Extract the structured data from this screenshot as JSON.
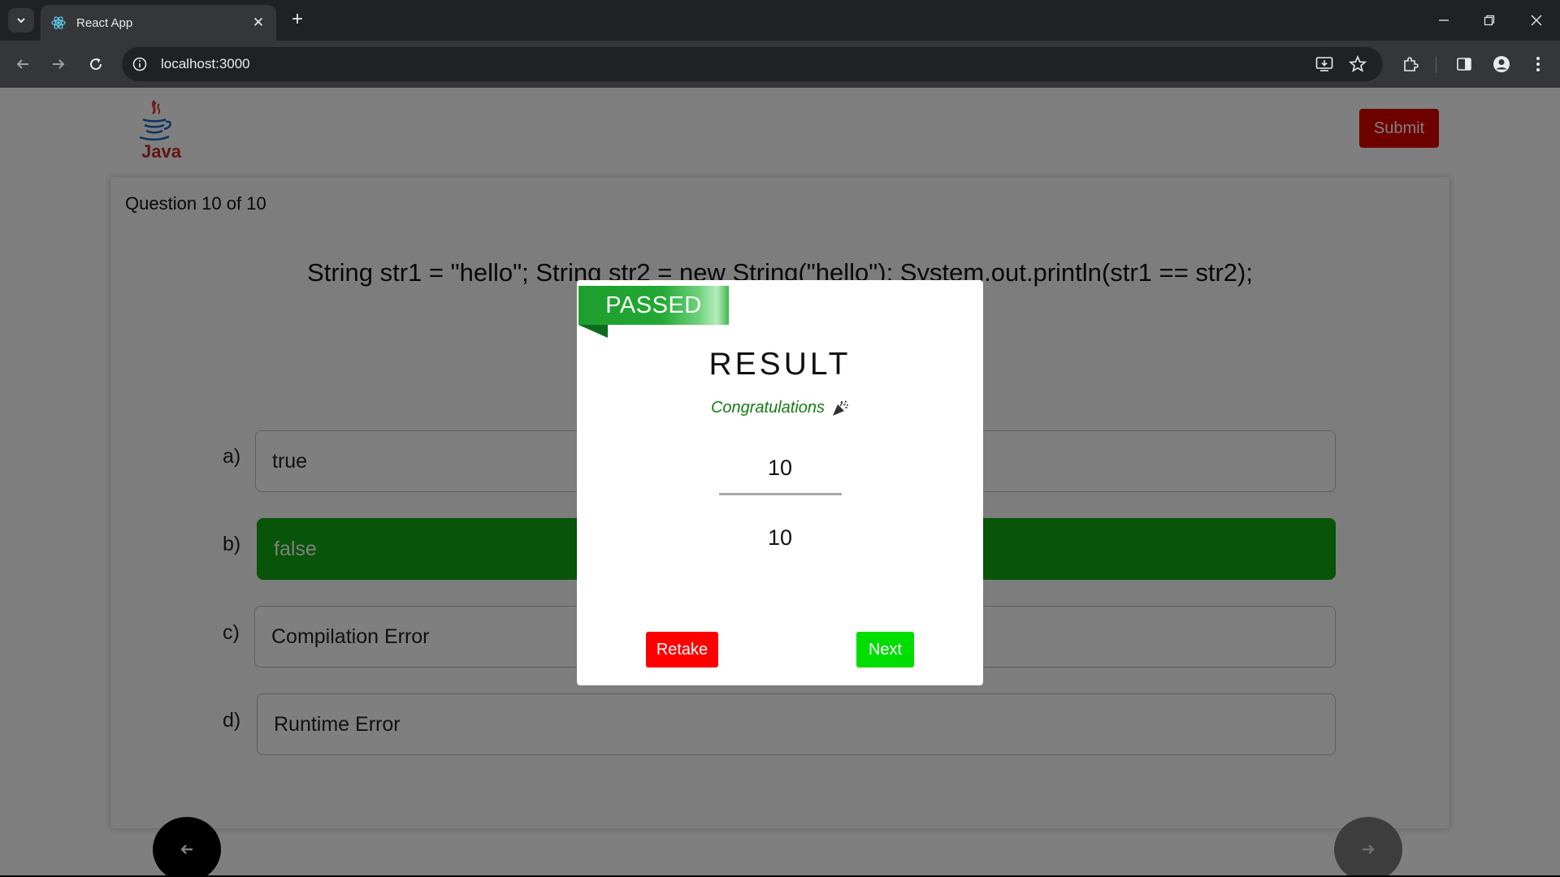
{
  "browser": {
    "tab_title": "React App",
    "url": "localhost:3000"
  },
  "header": {
    "logo_text": "Java",
    "submit_label": "Submit"
  },
  "quiz": {
    "question_counter": "Question 10 of 10",
    "question_text": "String str1 = \"hello\"; String str2 = new String(\"hello\"); System.out.println(str1 == str2);",
    "options": [
      {
        "letter": "a)",
        "text": "true",
        "selected": false
      },
      {
        "letter": "b)",
        "text": "false",
        "selected": true
      },
      {
        "letter": "c)",
        "text": "Compilation Error",
        "selected": false
      },
      {
        "letter": "d)",
        "text": "Runtime Error",
        "selected": false
      }
    ]
  },
  "modal": {
    "badge": "PASSED",
    "title": "RESULT",
    "message": "Congratulations",
    "score": "10",
    "total": "10",
    "retake_label": "Retake",
    "next_label": "Next"
  },
  "colors": {
    "selected_option": "#11a811",
    "submit": "#dc0000",
    "retake": "#ff0000",
    "next": "#00dd00",
    "passed_badge": "#22a834"
  }
}
